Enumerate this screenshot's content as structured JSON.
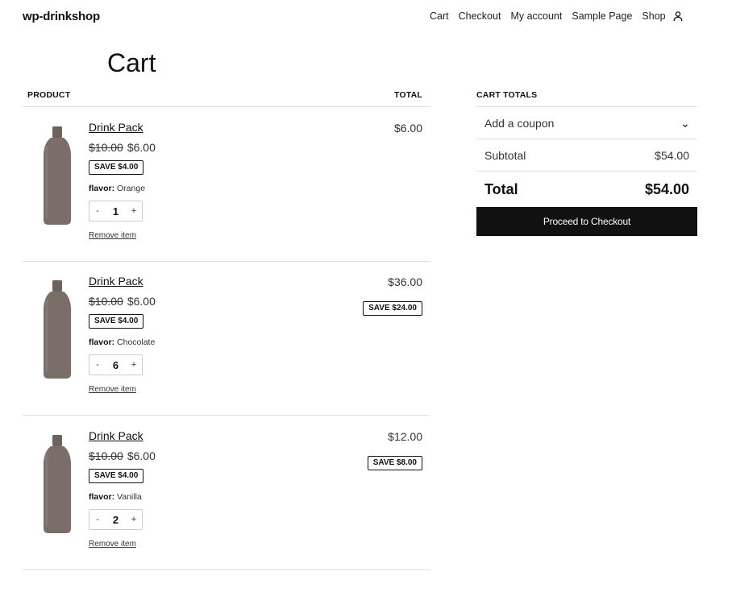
{
  "site": {
    "title": "wp-drinkshop"
  },
  "nav": {
    "items": [
      "Cart",
      "Checkout",
      "My account",
      "Sample Page",
      "Shop"
    ],
    "account_icon": "account-icon"
  },
  "page": {
    "title": "Cart"
  },
  "cart": {
    "columns": {
      "product": "PRODUCT",
      "total": "TOTAL"
    },
    "items": [
      {
        "name": "Drink Pack",
        "regular_price": "$10.00",
        "sale_price": "$6.00",
        "unit_save": "SAVE $4.00",
        "meta_key": "flavor:",
        "meta_value": "Orange",
        "qty": "1",
        "minus": "-",
        "plus": "+",
        "remove": "Remove item",
        "line_total": "$6.00",
        "line_save": ""
      },
      {
        "name": "Drink Pack",
        "regular_price": "$10.00",
        "sale_price": "$6.00",
        "unit_save": "SAVE $4.00",
        "meta_key": "flavor:",
        "meta_value": "Chocolate",
        "qty": "6",
        "minus": "-",
        "plus": "+",
        "remove": "Remove item",
        "line_total": "$36.00",
        "line_save": "SAVE $24.00"
      },
      {
        "name": "Drink Pack",
        "regular_price": "$10.00",
        "sale_price": "$6.00",
        "unit_save": "SAVE $4.00",
        "meta_key": "flavor:",
        "meta_value": "Vanilla",
        "qty": "2",
        "minus": "-",
        "plus": "+",
        "remove": "Remove item",
        "line_total": "$12.00",
        "line_save": "SAVE $8.00"
      }
    ]
  },
  "totals": {
    "heading": "CART TOTALS",
    "coupon_label": "Add a coupon",
    "subtotal_label": "Subtotal",
    "subtotal_value": "$54.00",
    "total_label": "Total",
    "total_value": "$54.00",
    "checkout_label": "Proceed to Checkout"
  },
  "colors": {
    "button_bg": "#111111",
    "product_color": "#7a6e69"
  }
}
